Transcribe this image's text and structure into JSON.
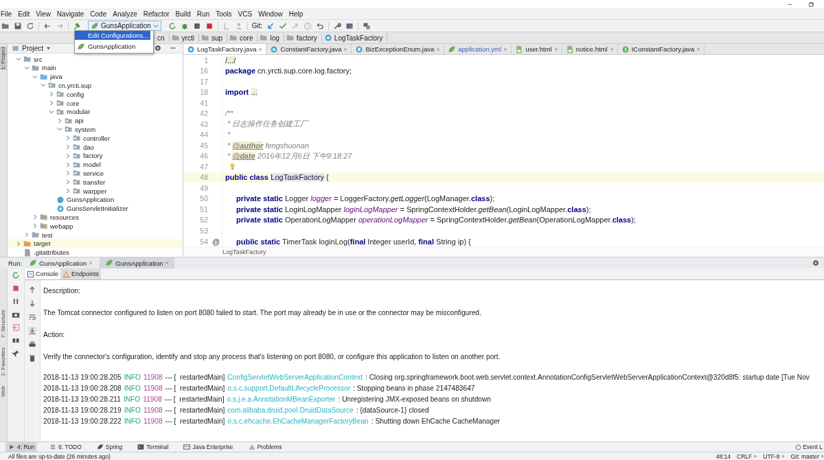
{
  "menu": [
    "File",
    "Edit",
    "View",
    "Navigate",
    "Code",
    "Analyze",
    "Refactor",
    "Build",
    "Run",
    "Tools",
    "VCS",
    "Window",
    "Help"
  ],
  "toolbar": {
    "run_config": "GunsApplication",
    "git_label": "Git:"
  },
  "run_config_dropdown": {
    "items": [
      {
        "label": "Edit Configurations...",
        "kind": "action",
        "selected": true
      },
      {
        "label": "GunsApplication",
        "kind": "config",
        "selected": false
      }
    ]
  },
  "breadcrumb": [
    {
      "label": "cn",
      "kind": "folder"
    },
    {
      "label": "yrcti",
      "kind": "folder"
    },
    {
      "label": "sup",
      "kind": "folder"
    },
    {
      "label": "core",
      "kind": "folder"
    },
    {
      "label": "log",
      "kind": "folder"
    },
    {
      "label": "factory",
      "kind": "folder"
    },
    {
      "label": "LogTaskFactory",
      "kind": "class"
    }
  ],
  "tool_strip": [
    "1: Project",
    "7: Structure",
    "2: Favorites",
    "Web"
  ],
  "project_panel": {
    "title": "Project",
    "tree": [
      {
        "label": "src",
        "kind": "folder",
        "expanded": true,
        "children": [
          {
            "label": "main",
            "kind": "folder",
            "expanded": true,
            "children": [
              {
                "label": "java",
                "kind": "source",
                "expanded": true,
                "children": [
                  {
                    "label": "cn.yrcti.sup",
                    "kind": "package",
                    "expanded": true,
                    "children": [
                      {
                        "label": "config",
                        "kind": "package",
                        "expanded": false
                      },
                      {
                        "label": "core",
                        "kind": "package",
                        "expanded": false
                      },
                      {
                        "label": "modular",
                        "kind": "package",
                        "expanded": true,
                        "children": [
                          {
                            "label": "api",
                            "kind": "package",
                            "expanded": false
                          },
                          {
                            "label": "system",
                            "kind": "package",
                            "expanded": true,
                            "children": [
                              {
                                "label": "controller",
                                "kind": "package",
                                "expanded": false
                              },
                              {
                                "label": "dao",
                                "kind": "package",
                                "expanded": false
                              },
                              {
                                "label": "factory",
                                "kind": "package",
                                "expanded": false
                              },
                              {
                                "label": "model",
                                "kind": "package",
                                "expanded": false
                              },
                              {
                                "label": "service",
                                "kind": "package",
                                "expanded": false
                              },
                              {
                                "label": "transfer",
                                "kind": "package",
                                "expanded": false
                              },
                              {
                                "label": "warpper",
                                "kind": "package",
                                "expanded": false
                              }
                            ]
                          }
                        ]
                      },
                      {
                        "label": "GunsApplication",
                        "kind": "app-class"
                      },
                      {
                        "label": "GunsServletInitializer",
                        "kind": "class"
                      }
                    ]
                  }
                ]
              },
              {
                "label": "resources",
                "kind": "resources",
                "expanded": false
              },
              {
                "label": "webapp",
                "kind": "resources",
                "expanded": false
              }
            ]
          },
          {
            "label": "test",
            "kind": "folder",
            "expanded": false
          }
        ]
      },
      {
        "label": "target",
        "kind": "excluded",
        "expanded": false
      },
      {
        "label": ".gitattributes",
        "kind": "file"
      }
    ]
  },
  "editor_tabs": [
    {
      "label": "LogTaskFactory.java",
      "kind": "class",
      "selected": true
    },
    {
      "label": "ConstantFactory.java",
      "kind": "class",
      "selected": false
    },
    {
      "label": "BizExceptionEnum.java",
      "kind": "enum",
      "selected": false
    },
    {
      "label": "application.yml",
      "kind": "yml",
      "selected": false
    },
    {
      "label": "user.html",
      "kind": "html",
      "selected": false
    },
    {
      "label": "notice.html",
      "kind": "html",
      "selected": false
    },
    {
      "label": "IConstantFactory.java",
      "kind": "interface",
      "selected": false
    }
  ],
  "code": [
    {
      "number": "1",
      "tokens": [
        {
          "kind": "folded",
          "text": "/.../"
        }
      ]
    },
    {
      "number": "16",
      "tokens": [
        {
          "kind": "kw",
          "text": "package"
        },
        {
          "kind": "text",
          "text": " cn.yrcti.sup.core.log.factory;"
        }
      ]
    },
    {
      "number": "17"
    },
    {
      "number": "18",
      "tokens": [
        {
          "kind": "kw",
          "text": "import"
        },
        {
          "kind": "folded",
          "text": "..."
        }
      ]
    },
    {
      "number": "41"
    },
    {
      "number": "42",
      "tokens": [
        {
          "kind": "comment",
          "text": "/**"
        }
      ]
    },
    {
      "number": "43",
      "tokens": [
        {
          "kind": "comment",
          "text": " * 日志操作任务创建工厂"
        }
      ]
    },
    {
      "number": "44",
      "tokens": [
        {
          "kind": "comment",
          "text": " *"
        }
      ]
    },
    {
      "number": "45",
      "tokens": [
        {
          "kind": "comment",
          "text": " * "
        },
        {
          "kind": "tag",
          "text": "@author"
        },
        {
          "kind": "comment",
          "text": " fengshuonan"
        }
      ]
    },
    {
      "number": "46",
      "tokens": [
        {
          "kind": "comment",
          "text": " * "
        },
        {
          "kind": "tag",
          "text": "@date"
        },
        {
          "kind": "comment",
          "text": " 2016年12月6日 下午9:18:27"
        }
      ]
    },
    {
      "number": "47",
      "bulb": true
    },
    {
      "number": "48",
      "current": true,
      "tokens": [
        {
          "kind": "kw",
          "text": "public class"
        },
        {
          "kind": "usage",
          "text": "LogTaskFactory"
        },
        {
          "kind": "text",
          "text": " {"
        }
      ]
    },
    {
      "number": "49"
    },
    {
      "number": "50",
      "indent": true,
      "tokens": [
        {
          "kind": "kw",
          "text": "private static"
        },
        {
          "kind": "text",
          "text": " Logger "
        },
        {
          "kind": "field",
          "text": "logger"
        },
        {
          "kind": "text",
          "text": " = LoggerFactory."
        },
        {
          "kind": "method",
          "text": "getLogger"
        },
        {
          "kind": "text",
          "text": "(LogManager."
        },
        {
          "kind": "kw",
          "text": "class"
        },
        {
          "kind": "text",
          "text": ");"
        }
      ]
    },
    {
      "number": "51",
      "indent": true,
      "tokens": [
        {
          "kind": "kw",
          "text": "private static"
        },
        {
          "kind": "text",
          "text": " LoginLogMapper "
        },
        {
          "kind": "field",
          "text": "loginLogMapper"
        },
        {
          "kind": "text",
          "text": " = SpringContextHolder."
        },
        {
          "kind": "method",
          "text": "getBean"
        },
        {
          "kind": "text",
          "text": "(LoginLogMapper."
        },
        {
          "kind": "kw",
          "text": "class"
        },
        {
          "kind": "text",
          "text": ");"
        }
      ]
    },
    {
      "number": "52",
      "indent": true,
      "tokens": [
        {
          "kind": "kw",
          "text": "private static"
        },
        {
          "kind": "text",
          "text": " OperationLogMapper "
        },
        {
          "kind": "field",
          "text": "operationLogMapper"
        },
        {
          "kind": "text",
          "text": " = SpringContextHolder."
        },
        {
          "kind": "method",
          "text": "getBean"
        },
        {
          "kind": "text",
          "text": "(OperationLogMapper."
        },
        {
          "kind": "kw",
          "text": "class"
        },
        {
          "kind": "text",
          "text": ");"
        }
      ]
    },
    {
      "number": "53"
    },
    {
      "number": "54",
      "gutter_mark": "@",
      "indent": true,
      "tokens": [
        {
          "kind": "kw",
          "text": "public static"
        },
        {
          "kind": "text",
          "text": " TimerTask loginLog("
        },
        {
          "kind": "kw",
          "text": "final"
        },
        {
          "kind": "text",
          "text": " Integer userId, "
        },
        {
          "kind": "kw",
          "text": "final"
        },
        {
          "kind": "text",
          "text": " String ip) {"
        }
      ]
    }
  ],
  "editor_breadcrumb": "LogTaskFactory",
  "run_panel": {
    "label": "Run:",
    "tabs": [
      {
        "label": "GunsApplication",
        "selected": false
      },
      {
        "label": "GunsApplication",
        "selected": true
      }
    ],
    "subtabs": [
      {
        "label": "Console",
        "kind": "console",
        "selected": true
      },
      {
        "label": "Endpoints",
        "kind": "endpoints",
        "selected": false
      }
    ],
    "console": [
      {
        "kind": "text",
        "text": "Description:"
      },
      {
        "kind": "text",
        "text": "The Tomcat connector configured to listen on port 8080 failed to start. The port may already be in use or the connector may be misconfigured."
      },
      {
        "kind": "text",
        "text": "Action:"
      },
      {
        "kind": "text",
        "text": "Verify the connector's configuration, identify and stop any process that's listening on port 8080, or configure this application to listen on another port."
      },
      {
        "kind": "log",
        "time": "2018-11-13 19:00:28.205",
        "level": "INFO",
        "pid": "11908",
        "thread": "--- [  restartedMain]",
        "logger": "ConfigServletWebServerApplicationContext",
        "message": ": Closing org.springframework.boot.web.servlet.context.AnnotationConfigServletWebServerApplicationContext@320d8f5: startup date [Tue Nov"
      },
      {
        "kind": "log",
        "time": "2018-11-13 19:00:28.208",
        "level": "INFO",
        "pid": "11908",
        "thread": "--- [  restartedMain]",
        "logger": "o.s.c.support.DefaultLifecycleProcessor",
        "message": ": Stopping beans in phase 2147483647"
      },
      {
        "kind": "log",
        "time": "2018-11-13 19:00:28.211",
        "level": "INFO",
        "pid": "11908",
        "thread": "--- [  restartedMain]",
        "logger": "o.s.j.e.a.AnnotationMBeanExporter",
        "message": ": Unregistering JMX-exposed beans on shutdown"
      },
      {
        "kind": "log",
        "time": "2018-11-13 19:00:28.219",
        "level": "INFO",
        "pid": "11908",
        "thread": "--- [  restartedMain]",
        "logger": "com.alibaba.druid.pool.DruidDataSource",
        "message": ": {dataSource-1} closed"
      },
      {
        "kind": "log",
        "time": "2018-11-13 19:00:28.222",
        "level": "INFO",
        "pid": "11908",
        "thread": "--- [  restartedMain]",
        "logger": "o.s.c.ehcache.EhCacheManagerFactoryBean",
        "message": ": Shutting down EhCache CacheManager"
      }
    ]
  },
  "bottom_tabs": [
    {
      "label": "4: Run",
      "kind": "run",
      "selected": true
    },
    {
      "label": "6: TODO",
      "kind": "todo",
      "selected": false
    },
    {
      "label": "Spring",
      "kind": "spring",
      "selected": false
    },
    {
      "label": "Terminal",
      "kind": "terminal",
      "selected": false
    },
    {
      "label": "Java Enterprise",
      "kind": "enterprise",
      "selected": false
    },
    {
      "label": "Problems",
      "kind": "problems",
      "selected": false
    }
  ],
  "event_log": "Event L",
  "status_bar": {
    "message": "All files are up-to-date (26 minutes ago)",
    "position": "48:14",
    "line_separator": "CRLF ÷",
    "encoding": "UTF-8 ÷",
    "vcs": "Git: master ÷"
  }
}
